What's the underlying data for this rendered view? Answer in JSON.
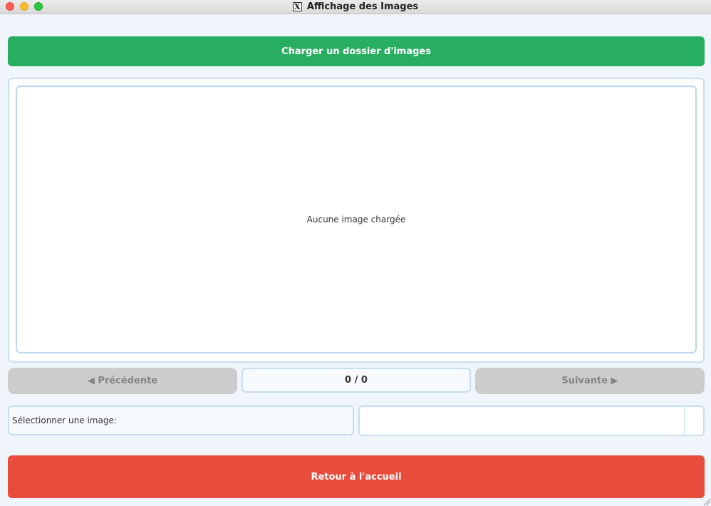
{
  "window": {
    "title": "Affichage des Images"
  },
  "toolbar": {
    "load_label": "Charger un dossier d'images"
  },
  "viewer": {
    "placeholder": "Aucune image chargée"
  },
  "navigation": {
    "prev_label": "◀ Précédente",
    "counter": "0 / 0",
    "next_label": "Suivante ▶"
  },
  "selection": {
    "label": "Sélectionner une image:",
    "selected_value": ""
  },
  "footer": {
    "return_label": "Retour à l'accueil"
  },
  "colors": {
    "load_button": "#27ae60",
    "return_button": "#e74c3c",
    "disabled_button": "#cccccc",
    "border_accent": "#c5dcf1",
    "background": "#f0f5fb"
  },
  "icons": [
    "close-icon",
    "minimize-icon",
    "maximize-icon",
    "x11-icon",
    "chevron-down-icon",
    "resize-grip-icon"
  ]
}
